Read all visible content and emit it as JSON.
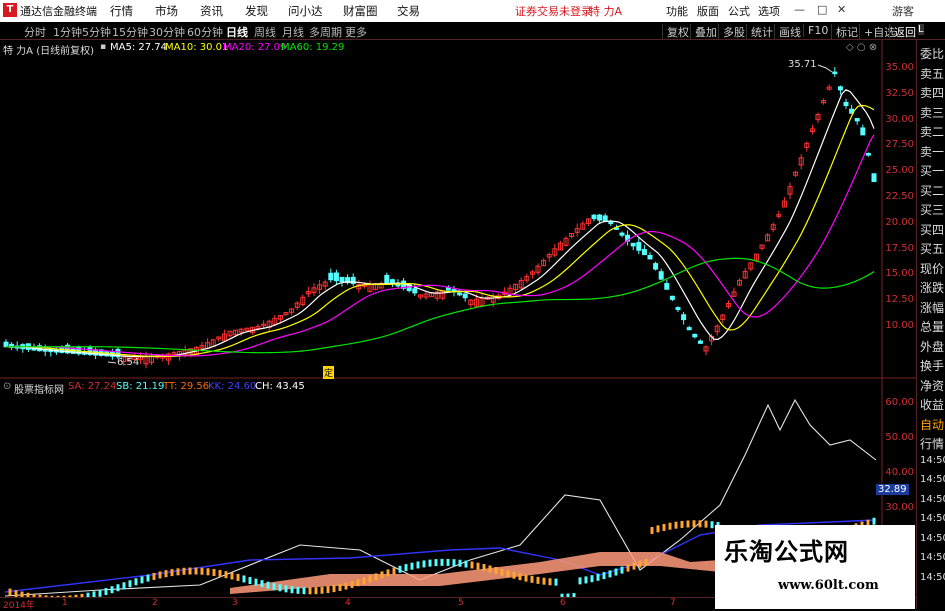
{
  "titlebar": {
    "logo": "T",
    "app_title": "通达信金融终端",
    "menus": [
      "行情",
      "市场",
      "资讯",
      "发现",
      "问小达",
      "财富圈",
      "交易"
    ],
    "warning": "证券交易未登录",
    "security": "特 力A",
    "right_buttons": [
      "功能",
      "版面",
      "公式",
      "选项"
    ],
    "guest": "游客"
  },
  "periods": [
    "分时",
    "1分钟",
    "5分钟",
    "15分钟",
    "30分钟",
    "60分钟",
    "日线",
    "周线",
    "月线",
    "多周期",
    "更多"
  ],
  "active_period": "日线",
  "right_tools": [
    "复权",
    "叠加",
    "多股",
    "统计",
    "画线",
    "F10",
    "标记",
    "+自选",
    "返回"
  ],
  "main_info": {
    "name": "特 力A (日线前复权)",
    "ma5": "MA5: 27.74",
    "ma10": "MA10: 30.01",
    "ma20": "MA20: 27.09",
    "ma60": "MA60: 19.29"
  },
  "sub_info": {
    "name": "股票指标网",
    "sa": "SA: 27.24",
    "sb": "SB: 21.19",
    "tt": "TT: 29.56",
    "kk": "KK: 24.60",
    "ch": "CH: 43.45"
  },
  "price_axis": [
    "35.00",
    "32.50",
    "30.00",
    "27.50",
    "25.00",
    "22.50",
    "20.00",
    "17.50",
    "15.00",
    "12.50",
    "10.00"
  ],
  "sub_axis": [
    "60.00",
    "50.00",
    "40.00",
    "30.00"
  ],
  "sub_current": "32.89",
  "annotations": {
    "high": "35.71",
    "low": "6.54",
    "mark": "定"
  },
  "right_panel": [
    "委比",
    "卖五",
    "卖四",
    "卖三",
    "卖二",
    "卖一",
    "买一",
    "买二",
    "买三",
    "买四",
    "买五",
    "现价",
    "涨跌",
    "涨幅",
    "总量",
    "外盘",
    "换手",
    "净资",
    "收益",
    "自动",
    "行情",
    "14:50",
    "14:50",
    "14:50",
    "14:50",
    "14:50",
    "14:50",
    "14:50"
  ],
  "x_axis": [
    "2014年",
    "1",
    "2",
    "3",
    "4",
    "5",
    "6",
    "7"
  ],
  "watermark": {
    "line1": "乐淘公式网",
    "line2": "www.60lt.com"
  },
  "colors": {
    "up": "#ff3232",
    "down": "#54ffff",
    "ma5": "#ffffff",
    "ma10": "#ffff00",
    "ma20": "#ff00ff",
    "ma60": "#00e600"
  }
}
